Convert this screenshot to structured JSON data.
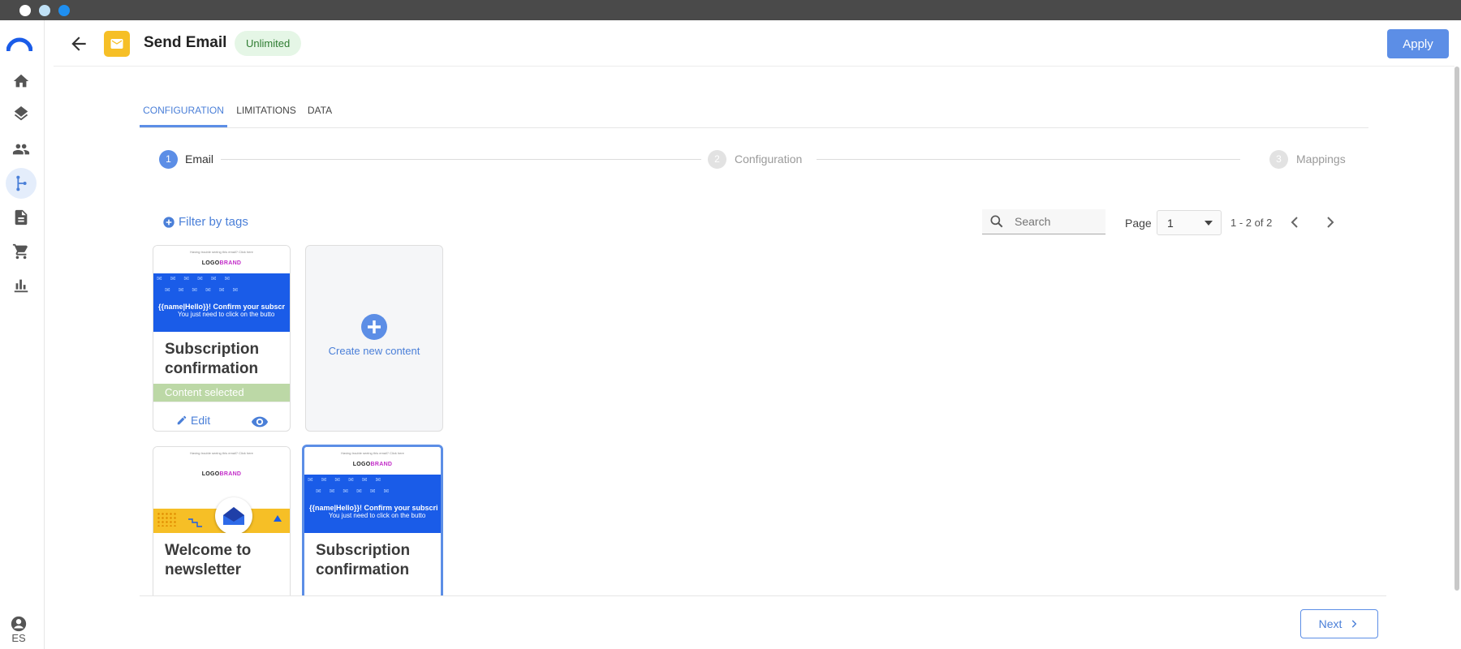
{
  "header": {
    "title": "Send Email",
    "badge": "Unlimited",
    "apply_label": "Apply"
  },
  "tabs": [
    {
      "label": "CONFIGURATION",
      "active": true
    },
    {
      "label": "LIMITATIONS",
      "active": false
    },
    {
      "label": "DATA",
      "active": false
    }
  ],
  "stepper": [
    {
      "number": "1",
      "label": "Email",
      "active": true
    },
    {
      "number": "2",
      "label": "Configuration",
      "active": false
    },
    {
      "number": "3",
      "label": "Mappings",
      "active": false
    }
  ],
  "toolbar": {
    "filter_label": "Filter by tags",
    "search_placeholder": "Search",
    "page_label": "Page",
    "page_value": "1",
    "page_range": "1 - 2 of 2"
  },
  "cards": [
    {
      "title": "Subscription confirmation",
      "thumb_top": "Having trouble seeing this email? Click here",
      "logo": "LOGO",
      "brand": "BRAND",
      "banner_line1": "{{name|Hello}}! Confirm your subscr",
      "banner_line2": "You just need to click on the butto",
      "status": "Content selected",
      "edit_label": "Edit"
    },
    {
      "title": "Welcome to newsletter",
      "thumb_top": "Having trouble seeing this email? Click here",
      "logo": "LOGO",
      "brand": "BRAND"
    },
    {
      "title": "Subscription confirmation",
      "thumb_top": "Having trouble seeing this email? Click here",
      "logo": "LOGO",
      "brand": "BRAND",
      "banner_line1": "{{name|Hello}}! Confirm your subscri",
      "banner_line2": "You just need to click on the butto"
    }
  ],
  "create_card": {
    "label": "Create new content"
  },
  "footer": {
    "next_label": "Next"
  },
  "rail": {
    "language": "ES"
  },
  "colors": {
    "accent": "#5c8ee6",
    "selected_green": "#bcd8a6",
    "mail_tile": "#f6bf26",
    "banner_blue": "#1a5ce8"
  }
}
